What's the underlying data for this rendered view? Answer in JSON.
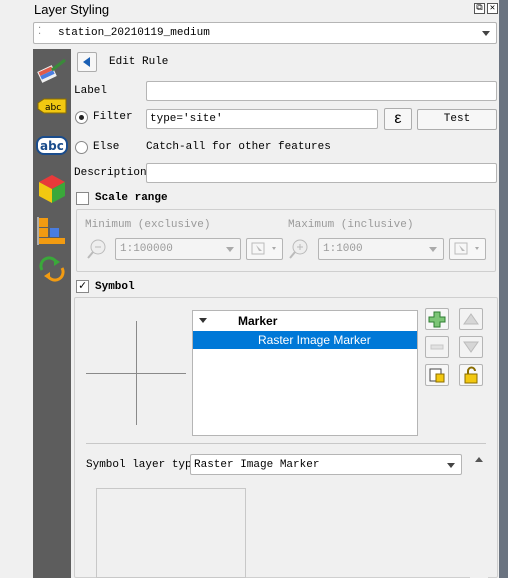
{
  "window": {
    "title": "Layer Styling",
    "float_glyph": "⧉",
    "close_glyph": "✕"
  },
  "layer_combo": {
    "value": "station_20210119_medium"
  },
  "sidebar": {
    "icons": [
      "paintbrush-icon",
      "labels-abc-yellow-icon",
      "labels-abc-icon",
      "3d-cube-icon",
      "diagram-icon",
      "history-icon"
    ],
    "label_badge_text": "abc",
    "label_badge_text_2": "abc"
  },
  "rule_editor": {
    "header_label": "Edit Rule",
    "label_caption": "Label",
    "label_value": "",
    "filter_caption": "Filter",
    "filter_value": "type='site'",
    "expression_button": "ε",
    "test_button": "Test",
    "else_caption": "Else",
    "else_text": "Catch-all for other features",
    "description_caption": "Description",
    "description_value": "",
    "scale_range_label": "Scale range",
    "minimum_label": "Minimum (exclusive)",
    "maximum_label": "Maximum (inclusive)",
    "min_scale": "1:100000",
    "max_scale": "1:1000",
    "symbol_label": "Symbol",
    "symbol_checked": "✓"
  },
  "symbol_tree": {
    "items": [
      {
        "label": "Marker",
        "level": 0,
        "selected": false
      },
      {
        "label": "Raster Image Marker",
        "level": 1,
        "selected": true
      }
    ]
  },
  "symbol_layer": {
    "caption": "Symbol layer type",
    "value": "Raster Image Marker"
  },
  "colors": {
    "selection": "#0078d7",
    "sidebar_bg": "#5d5d5d"
  }
}
